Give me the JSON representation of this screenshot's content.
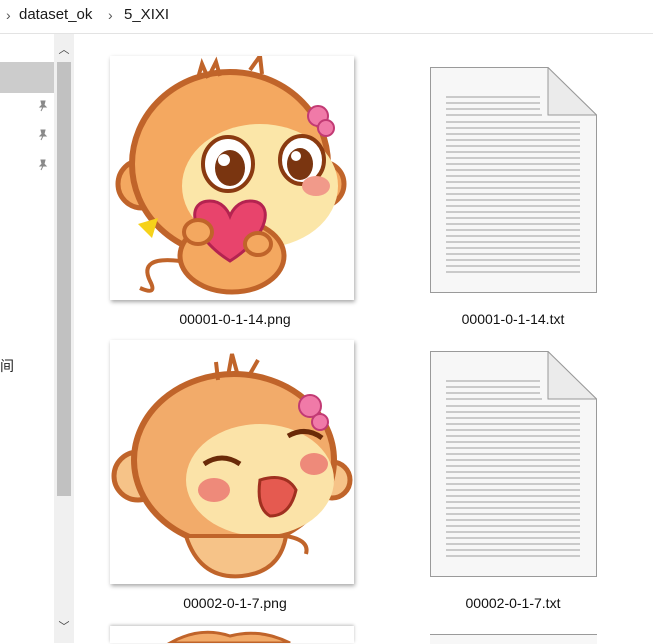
{
  "breadcrumb": {
    "items": [
      "dataset_ok",
      "5_XIXI"
    ]
  },
  "nav": {
    "partial_label": "间"
  },
  "files": [
    {
      "name": "00001-0-1-14.png",
      "type": "image"
    },
    {
      "name": "00001-0-1-14.txt",
      "type": "text"
    },
    {
      "name": "00002-0-1-7.png",
      "type": "image"
    },
    {
      "name": "00002-0-1-7.txt",
      "type": "text"
    }
  ],
  "colors": {
    "selection": "#cccccc",
    "monkey_face": "#f4a860",
    "monkey_outline": "#c0642a",
    "heart": "#e8446c",
    "bow": "#f07aa8"
  }
}
